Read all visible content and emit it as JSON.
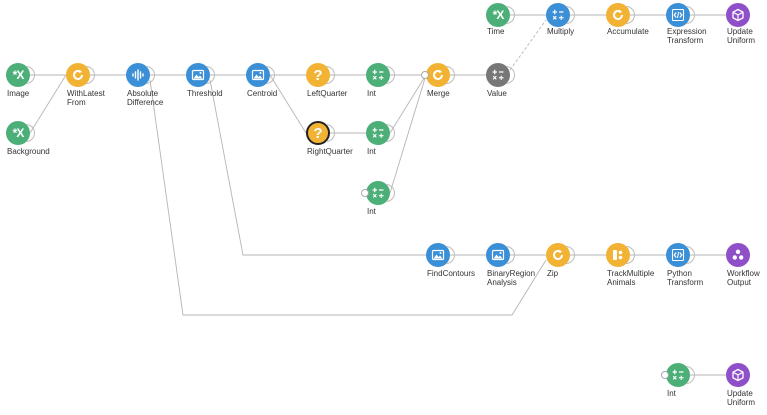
{
  "colors": {
    "source": "#4caf78",
    "combinator": "#f2b233",
    "transform": "#3b8fd6",
    "condition": "#f2b233",
    "sink": "#8e4fc9",
    "operator": "#777777",
    "edge": "#b5b5b5"
  },
  "nodes": [
    {
      "id": "image",
      "label": "Image",
      "kind": "source",
      "icon": "source-x-icon"
    },
    {
      "id": "background",
      "label": "Background",
      "kind": "source",
      "icon": "source-x-icon"
    },
    {
      "id": "withlatest",
      "label": "WithLatest\nFrom",
      "kind": "combinator",
      "icon": "refresh-icon"
    },
    {
      "id": "absdiff",
      "label": "Absolute\nDifference",
      "kind": "transform",
      "icon": "waveform-icon"
    },
    {
      "id": "threshold",
      "label": "Threshold",
      "kind": "transform",
      "icon": "image-icon"
    },
    {
      "id": "centroid",
      "label": "Centroid",
      "kind": "transform",
      "icon": "image-icon"
    },
    {
      "id": "leftquarter",
      "label": "LeftQuarter",
      "kind": "condition",
      "icon": "question-icon"
    },
    {
      "id": "rightquarter",
      "label": "RightQuarter",
      "kind": "condition",
      "icon": "question-icon",
      "outlined": true
    },
    {
      "id": "int1",
      "label": "Int",
      "kind": "source",
      "icon": "calculator-icon"
    },
    {
      "id": "int2",
      "label": "Int",
      "kind": "source",
      "icon": "calculator-icon"
    },
    {
      "id": "int3",
      "label": "Int",
      "kind": "source",
      "icon": "calculator-icon"
    },
    {
      "id": "merge",
      "label": "Merge",
      "kind": "combinator",
      "icon": "refresh-icon"
    },
    {
      "id": "value",
      "label": "Value",
      "kind": "operator",
      "icon": "calculator-icon"
    },
    {
      "id": "time",
      "label": "Time",
      "kind": "source",
      "icon": "source-x-icon"
    },
    {
      "id": "multiply",
      "label": "Multiply",
      "kind": "transform",
      "icon": "calculator-icon"
    },
    {
      "id": "accumulate",
      "label": "Accumulate",
      "kind": "combinator",
      "icon": "refresh-icon"
    },
    {
      "id": "exprtransform",
      "label": "Expression\nTransform",
      "kind": "transform",
      "icon": "code-icon"
    },
    {
      "id": "updateuniform1",
      "label": "Update\nUniform",
      "kind": "sink",
      "icon": "cube-icon"
    },
    {
      "id": "findcontours",
      "label": "FindContours",
      "kind": "transform",
      "icon": "image-icon"
    },
    {
      "id": "binaryregion",
      "label": "BinaryRegion\nAnalysis",
      "kind": "transform",
      "icon": "image-icon"
    },
    {
      "id": "zip",
      "label": "Zip",
      "kind": "combinator",
      "icon": "refresh-icon"
    },
    {
      "id": "trackmultiple",
      "label": "TrackMultiple\nAnimals",
      "kind": "combinator",
      "icon": "grid-icon"
    },
    {
      "id": "pythontransform",
      "label": "Python\nTransform",
      "kind": "transform",
      "icon": "code-icon"
    },
    {
      "id": "workflowoutput",
      "label": "Workflow\nOutput",
      "kind": "sink",
      "icon": "output-icon"
    },
    {
      "id": "int4",
      "label": "Int",
      "kind": "source",
      "icon": "calculator-icon"
    },
    {
      "id": "updateuniform2",
      "label": "Update\nUniform",
      "kind": "sink",
      "icon": "cube-icon"
    }
  ],
  "edges": [
    [
      "image",
      "withlatest"
    ],
    [
      "background",
      "withlatest"
    ],
    [
      "withlatest",
      "absdiff"
    ],
    [
      "absdiff",
      "threshold"
    ],
    [
      "threshold",
      "centroid"
    ],
    [
      "centroid",
      "leftquarter"
    ],
    [
      "centroid",
      "rightquarter"
    ],
    [
      "leftquarter",
      "int1"
    ],
    [
      "rightquarter",
      "int2"
    ],
    [
      "int1",
      "merge"
    ],
    [
      "int2",
      "merge"
    ],
    [
      "int3",
      "merge"
    ],
    [
      "merge",
      "value"
    ],
    [
      "value",
      "multiply"
    ],
    [
      "time",
      "multiply"
    ],
    [
      "multiply",
      "accumulate"
    ],
    [
      "accumulate",
      "exprtransform"
    ],
    [
      "exprtransform",
      "updateuniform1"
    ],
    [
      "threshold",
      "findcontours"
    ],
    [
      "findcontours",
      "binaryregion"
    ],
    [
      "binaryregion",
      "zip"
    ],
    [
      "absdiff",
      "zip"
    ],
    [
      "zip",
      "trackmultiple"
    ],
    [
      "trackmultiple",
      "pythontransform"
    ],
    [
      "pythontransform",
      "workflowoutput"
    ],
    [
      "int4",
      "updateuniform2"
    ]
  ]
}
